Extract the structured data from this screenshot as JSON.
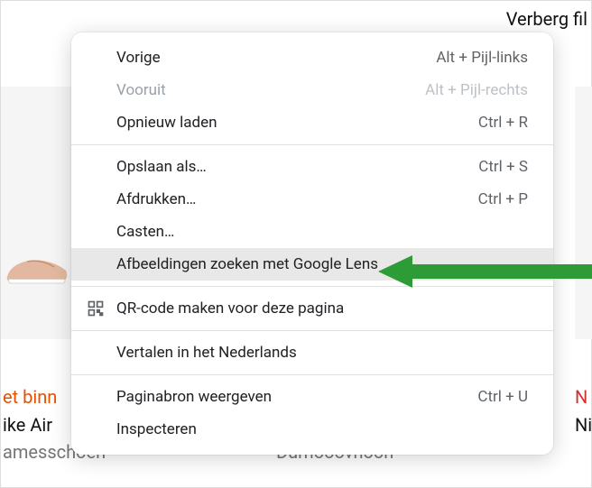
{
  "header": {
    "text": "Verberg fil"
  },
  "bg": {
    "t1": "et binn",
    "t2": "ike Air",
    "t3": "amesschoen",
    "t4": "Dumooovnoon",
    "t5": "N",
    "t6": "Ni"
  },
  "menu": {
    "items": [
      {
        "label": "Vorige",
        "shortcut": "Alt + Pijl-links",
        "disabled": false
      },
      {
        "label": "Vooruit",
        "shortcut": "Alt + Pijl-rechts",
        "disabled": true
      },
      {
        "label": "Opnieuw laden",
        "shortcut": "Ctrl + R",
        "disabled": false
      }
    ],
    "items2": [
      {
        "label": "Opslaan als…",
        "shortcut": "Ctrl + S"
      },
      {
        "label": "Afdrukken…",
        "shortcut": "Ctrl + P"
      },
      {
        "label": "Casten…",
        "shortcut": ""
      },
      {
        "label": "Afbeeldingen zoeken met Google Lens",
        "shortcut": ""
      }
    ],
    "qr": {
      "label": "QR-code maken voor deze pagina"
    },
    "translate": {
      "label": "Vertalen in het Nederlands"
    },
    "items3": [
      {
        "label": "Paginabron weergeven",
        "shortcut": "Ctrl + U"
      },
      {
        "label": "Inspecteren",
        "shortcut": ""
      }
    ]
  },
  "arrow": {
    "color": "#2e9c36"
  }
}
